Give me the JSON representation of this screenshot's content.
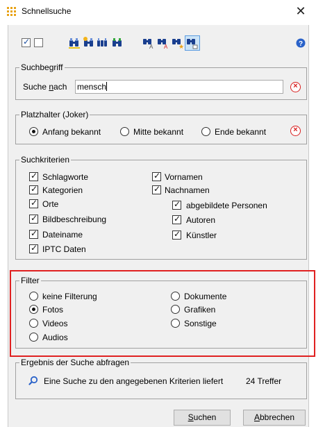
{
  "window": {
    "title": "Schnellsuche"
  },
  "colors": {
    "accent": "#e02020",
    "face": "#f0f0f0",
    "clear": "#d81e1e"
  },
  "toolbar": {
    "check_all": true,
    "uncheck_all": false,
    "icons": [
      "binoculars-icon",
      "binoculars-add-icon",
      "binoculars-multi-icon",
      "binoculars-green-icon",
      "binoculars-a-icon",
      "binoculars-red-a-icon",
      "binoculars-star-icon",
      "binoculars-selected-icon",
      "help-icon"
    ]
  },
  "suchbegriff": {
    "legend": "Suchbegriff",
    "label_pre": "Suche ",
    "label_u": "n",
    "label_post": "ach",
    "value": "mensch"
  },
  "platzhalter": {
    "legend": "Platzhalter (Joker)",
    "options": [
      {
        "label": "Anfang bekannt",
        "selected": true
      },
      {
        "label": "Mitte bekannt",
        "selected": false
      },
      {
        "label": "Ende bekannt",
        "selected": false
      }
    ]
  },
  "kriterien": {
    "legend": "Suchkriterien",
    "items": [
      {
        "label": "Schlagworte",
        "checked": true
      },
      {
        "label": "Kategorien",
        "checked": true
      },
      {
        "label": "Orte",
        "checked": true
      },
      {
        "label": "Bildbeschreibung",
        "checked": true
      },
      {
        "label": "Dateiname",
        "checked": true
      },
      {
        "label": "IPTC Daten",
        "checked": true
      },
      {
        "label": "Vornamen",
        "checked": true
      },
      {
        "label": "Nachnamen",
        "checked": true
      },
      {
        "label": "abgebildete Personen",
        "checked": true
      },
      {
        "label": "Autoren",
        "checked": true
      },
      {
        "label": "Künstler",
        "checked": true
      }
    ]
  },
  "filter": {
    "legend": "Filter",
    "options": [
      {
        "label": "keine Filterung",
        "selected": false
      },
      {
        "label": "Fotos",
        "selected": true
      },
      {
        "label": "Videos",
        "selected": false
      },
      {
        "label": "Audios",
        "selected": false
      },
      {
        "label": "Dokumente",
        "selected": false
      },
      {
        "label": "Grafiken",
        "selected": false
      },
      {
        "label": "Sonstige",
        "selected": false
      }
    ]
  },
  "ergebnis": {
    "legend": "Ergebnis der Suche abfragen",
    "text": "Eine Suche zu den angegebenen Kriterien liefert",
    "count": "24 Treffer"
  },
  "buttons": {
    "search_u": "S",
    "search_rest": "uchen",
    "cancel_u": "A",
    "cancel_rest": "bbrechen"
  }
}
